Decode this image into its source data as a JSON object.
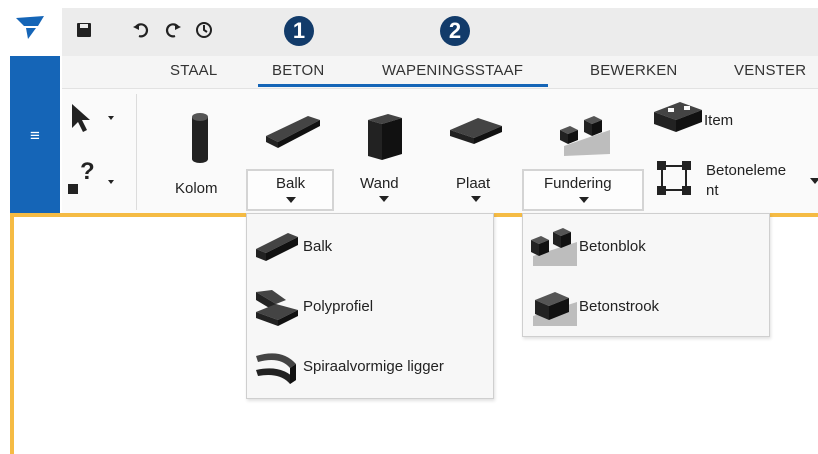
{
  "quick_access": {
    "logo": "app-logo",
    "save_icon": "save-icon",
    "undo_icon": "undo-icon",
    "redo_icon": "redo-icon",
    "history_icon": "history-icon"
  },
  "callouts": [
    "1",
    "2"
  ],
  "tabs": [
    {
      "label": "STAAL"
    },
    {
      "label": "BETON",
      "active": true
    },
    {
      "label": "WAPENINGSSTAAF"
    },
    {
      "label": "BEWERKEN"
    },
    {
      "label": "VENSTER"
    }
  ],
  "menu_button": "≡",
  "ribbon": {
    "kolom": "Kolom",
    "balk": "Balk",
    "wand": "Wand",
    "plaat": "Plaat",
    "fundering": "Fundering",
    "item": "Item",
    "betonelement_line1": "Betoneleme",
    "betonelement_line2": "nt",
    "select_glyph": "▾",
    "help_glyph": "?"
  },
  "balk_menu": [
    {
      "label": "Balk",
      "icon": "beam-icon"
    },
    {
      "label": "Polyprofiel",
      "icon": "polybeam-icon"
    },
    {
      "label": "Spiraalvormige ligger",
      "icon": "spiral-beam-icon"
    }
  ],
  "fundering_menu": [
    {
      "label": "Betonblok",
      "icon": "pad-footing-icon"
    },
    {
      "label": "Betonstrook",
      "icon": "strip-footing-icon"
    }
  ],
  "colors": {
    "brand_blue": "#1565b7",
    "accent_orange": "#f5bb44",
    "callout_navy": "#123b6a"
  }
}
